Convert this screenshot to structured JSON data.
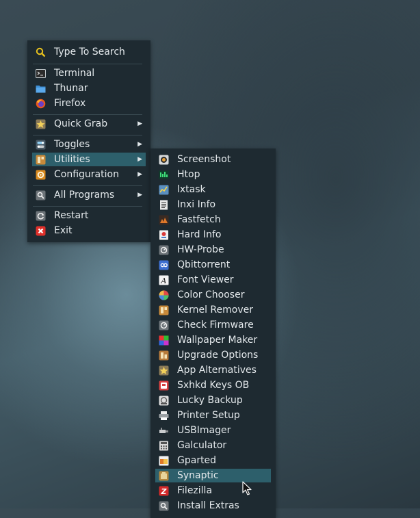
{
  "main_menu": {
    "search_label": "Type To Search",
    "terminal_label": "Terminal",
    "thunar_label": "Thunar",
    "firefox_label": "Firefox",
    "quick_grab_label": "Quick Grab",
    "toggles_label": "Toggles",
    "utilities_label": "Utilities",
    "configuration_label": "Configuration",
    "all_programs_label": "All Programs",
    "restart_label": "Restart",
    "exit_label": "Exit",
    "submenu_arrow": "▶"
  },
  "utilities_menu": {
    "items": [
      {
        "label": "Screenshot",
        "icon": "screenshot-icon"
      },
      {
        "label": "Htop",
        "icon": "htop-icon"
      },
      {
        "label": "lxtask",
        "icon": "lxtask-icon"
      },
      {
        "label": "Inxi Info",
        "icon": "inxi-info-icon"
      },
      {
        "label": "Fastfetch",
        "icon": "fastfetch-icon"
      },
      {
        "label": "Hard Info",
        "icon": "hard-info-icon"
      },
      {
        "label": "HW-Probe",
        "icon": "hw-probe-icon"
      },
      {
        "label": "Qbittorrent",
        "icon": "qbittorrent-icon"
      },
      {
        "label": "Font Viewer",
        "icon": "font-viewer-icon"
      },
      {
        "label": "Color Chooser",
        "icon": "color-chooser-icon"
      },
      {
        "label": "Kernel Remover",
        "icon": "kernel-remover-icon"
      },
      {
        "label": "Check Firmware",
        "icon": "check-firmware-icon"
      },
      {
        "label": "Wallpaper Maker",
        "icon": "wallpaper-maker-icon"
      },
      {
        "label": "Upgrade Options",
        "icon": "upgrade-options-icon"
      },
      {
        "label": "App Alternatives",
        "icon": "app-alternatives-icon"
      },
      {
        "label": "Sxhkd Keys OB",
        "icon": "sxhkd-keys-icon"
      },
      {
        "label": "Lucky Backup",
        "icon": "lucky-backup-icon"
      },
      {
        "label": "Printer Setup",
        "icon": "printer-setup-icon"
      },
      {
        "label": "USBImager",
        "icon": "usbimager-icon"
      },
      {
        "label": "Galculator",
        "icon": "galculator-icon"
      },
      {
        "label": "Gparted",
        "icon": "gparted-icon"
      },
      {
        "label": "Synaptic",
        "icon": "synaptic-icon"
      },
      {
        "label": "Filezilla",
        "icon": "filezilla-icon"
      },
      {
        "label": "Install Extras",
        "icon": "install-extras-icon"
      }
    ],
    "highlighted": "Synaptic"
  },
  "colors": {
    "menu_bg": "#1e2a31",
    "highlight": "#2d5f6b",
    "text": "#e4e9ec"
  }
}
